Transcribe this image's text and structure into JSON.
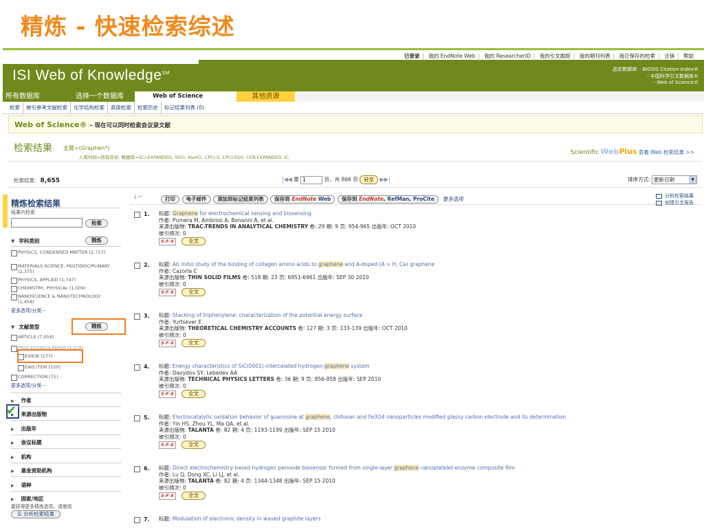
{
  "slide_title": "精炼 - 快速检索综述",
  "top_links": [
    "已登录",
    "我的 EndNote Web",
    "我的 ResearcherID",
    "我的引文跟踪",
    "我的期刊列表",
    "我已保存的检索",
    "注销",
    "帮助"
  ],
  "header": {
    "logo": "ISI Web of Knowledge",
    "logo_mark": "SM",
    "db_label": "选定数据库:",
    "db_lines": [
      "- BIOSIS Citation Index®",
      "- 中国科学引文数据库®",
      "- Web of Science®"
    ]
  },
  "tabs": [
    "所有数据库",
    "选择一个数据库",
    "Web of Science",
    "其他资源"
  ],
  "subnav": [
    "检索",
    "被引参考文献检索",
    "化学结构检索",
    "高级检索",
    "检索历史",
    "标记结果列表 (0)"
  ],
  "wos_bar": {
    "title": "Web of Science®",
    "subtitle": "– 现在可以同时检索会议录文献"
  },
  "results_head": {
    "title": "检索结果",
    "topic": "主题=(Graphen*)",
    "range": "入库时间=所有年份. 数据库=SCI-EXPANDED, SSCI, A&HCI, CPCI-S, CPCI-SSH, CCR-EXPANDED, IC.",
    "webplus_sci": "Scientific",
    "webplus_web": "Web",
    "webplus_plus": "Plus",
    "webplus_link": "查看 Web 检索结果 >>"
  },
  "countbar": {
    "label": "检索结果:",
    "count": "8,655",
    "page_prefix": "第",
    "page_value": "1",
    "page_suffix": "页，共 866 页",
    "goto": "转至",
    "sort_label": "排序方式:",
    "sort_value": "更新日期"
  },
  "sidebar": {
    "title": "精炼检索结果",
    "search_in": "结果内检索",
    "search_btn": "检索",
    "refine_btn": "精炼",
    "subject": {
      "label": "学科类别",
      "items": [
        "PHYSICS, CONDENSED MATTER (2,717)",
        "MATERIALS SCIENCE, MULTIDISCIPLINARY (2,375)",
        "PHYSICS, APPLIED (1,747)",
        "CHEMISTRY, PHYSICAL (1,509)",
        "NANOSCIENCE & NANOTECHNOLOGY (1,458)"
      ],
      "more": "更多选项/分类···"
    },
    "doctype": {
      "label": "文献类型",
      "items": [
        "ARTICLE (7,054)",
        "PROCEEDINGS PAPER (1,078)",
        "EVIEW (177)",
        "EWS ITEM (150)",
        "CORRECTION (71)"
      ],
      "more": "更多选项/分类···"
    },
    "collapsed": [
      "作者",
      "来源出版物",
      "出版年",
      "会议标题",
      "机构",
      "基金资助机构",
      "语种",
      "国家/地区"
    ],
    "footer": "要获得更多精炼选项，请使用",
    "analyze_btn": "分析检索结果"
  },
  "actions": {
    "buttons": [
      "打印",
      "电子邮件",
      "添加到标记结果列表",
      "保存到",
      "保存到"
    ],
    "endnote": "EndNote",
    "endnote_web": "Web",
    "refman": "RefMan, ProCite",
    "more": "更多选项",
    "analyze": "分析检索结果",
    "citation_report": "创建引文报告"
  },
  "labels": {
    "title": "标题:",
    "author": "作者:",
    "source": "来源出版物:",
    "cited": "被引频次:",
    "fulltext": "全文",
    "sfx": "S·F·X"
  },
  "records": [
    {
      "num": "1.",
      "title_pre": "",
      "title_hl": "Graphene",
      "title_post": " for electrochemical sensing and biosensing",
      "authors": "Pumera M, Ambrosi A, Bonanni A, et al.",
      "source": "TRAC-TRENDS IN ANALYTICAL CHEMISTRY",
      "meta": "卷: 29  期: 9  页: 954-965  出版年: OCT 2010",
      "cited": "0"
    },
    {
      "num": "2.",
      "title_pre": "Ab initio study of the binding of collagen amino acids to ",
      "title_hl": "graphene",
      "title_post": " and A-doped (A = H, Ca) graphene",
      "authors": "Cazorla C",
      "source": "THIN SOLID FILMS",
      "meta": "卷: 518  期: 23  页: 6951-6961  出版年: SEP 30 2010",
      "cited": "0"
    },
    {
      "num": "3.",
      "title_pre": "Stacking of triphenylene: characterization of the potential energy surface",
      "title_hl": "",
      "title_post": "",
      "authors": "Yurtsever E",
      "source": "THEORETICAL CHEMISTRY ACCOUNTS",
      "meta": "卷: 127  期: 3  页: 133-139  出版年: OCT 2010",
      "cited": "0"
    },
    {
      "num": "4.",
      "title_pre": "Energy characteristics of SiC(0001)-intercalated hydrogen-",
      "title_hl": "graphene",
      "title_post": " system",
      "authors": "Davydov SY, Lebedev AA",
      "source": "TECHNICAL PHYSICS LETTERS",
      "meta": "卷: 36  期: 9  页: 856-858  出版年: SEP 2010",
      "cited": "0"
    },
    {
      "num": "5.",
      "title_pre": "Electrocatalytic oxidation behavior of guanosine at ",
      "title_hl": "graphene",
      "title_post": ", chitosan and Fe3O4 nanoparticles modified glassy carbon electrode and its determination",
      "authors": "Yin HS, Zhou YL, Ma QA, et al.",
      "source": "TALANTA",
      "meta": "卷: 82  期: 4  页: 1193-1199  出版年: SEP 15 2010",
      "cited": "0"
    },
    {
      "num": "6.",
      "title_pre": "Direct electrochemistry-based hydrogen peroxide biosensor formed from single-layer ",
      "title_hl": "graphene",
      "title_post": " nanoplatelet-enzyme composite film",
      "authors": "Lu Q, Dong XC, Li LJ, et al.",
      "source": "TALANTA",
      "meta": "卷: 82  期: 4  页: 1344-1348  出版年: SEP 15 2010",
      "cited": "0"
    },
    {
      "num": "7.",
      "title_pre": "Modulation of electronic density in waved graphite layers",
      "title_hl": "",
      "title_post": "",
      "authors": "",
      "source": "",
      "meta": "",
      "cited": ""
    }
  ]
}
